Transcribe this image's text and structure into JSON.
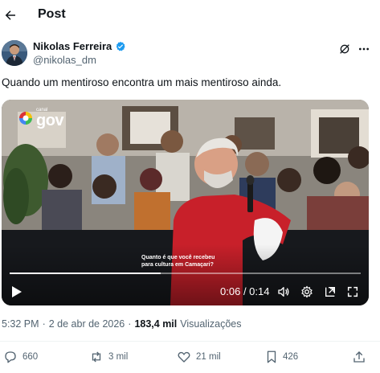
{
  "header": {
    "title": "Post"
  },
  "author": {
    "name": "Nikolas Ferreira",
    "handle": "@nikolas_dm",
    "verified": true
  },
  "tweet": {
    "text": "Quando um mentiroso encontra um mais mentiroso ainda."
  },
  "video": {
    "channel_logo_text": "gov",
    "channel_logo_small": "canal",
    "caption_line1": "Quanto é que você recebeu",
    "caption_line2": "para cultura em Camaçari?",
    "current_time": "0:06",
    "duration": "0:14",
    "progress": 0.43
  },
  "meta": {
    "time": "5:32 PM",
    "date": "2 de abr de 2026",
    "separator": "·",
    "views_count": "183,4 mil",
    "views_label": "Visualizações"
  },
  "actions": {
    "replies": "660",
    "reposts": "3 mil",
    "likes": "21 mil",
    "bookmarks": "426"
  },
  "colors": {
    "text": "#0f1419",
    "secondary": "#536471",
    "verified": "#1d9bf0",
    "divider": "#eff3f4"
  }
}
